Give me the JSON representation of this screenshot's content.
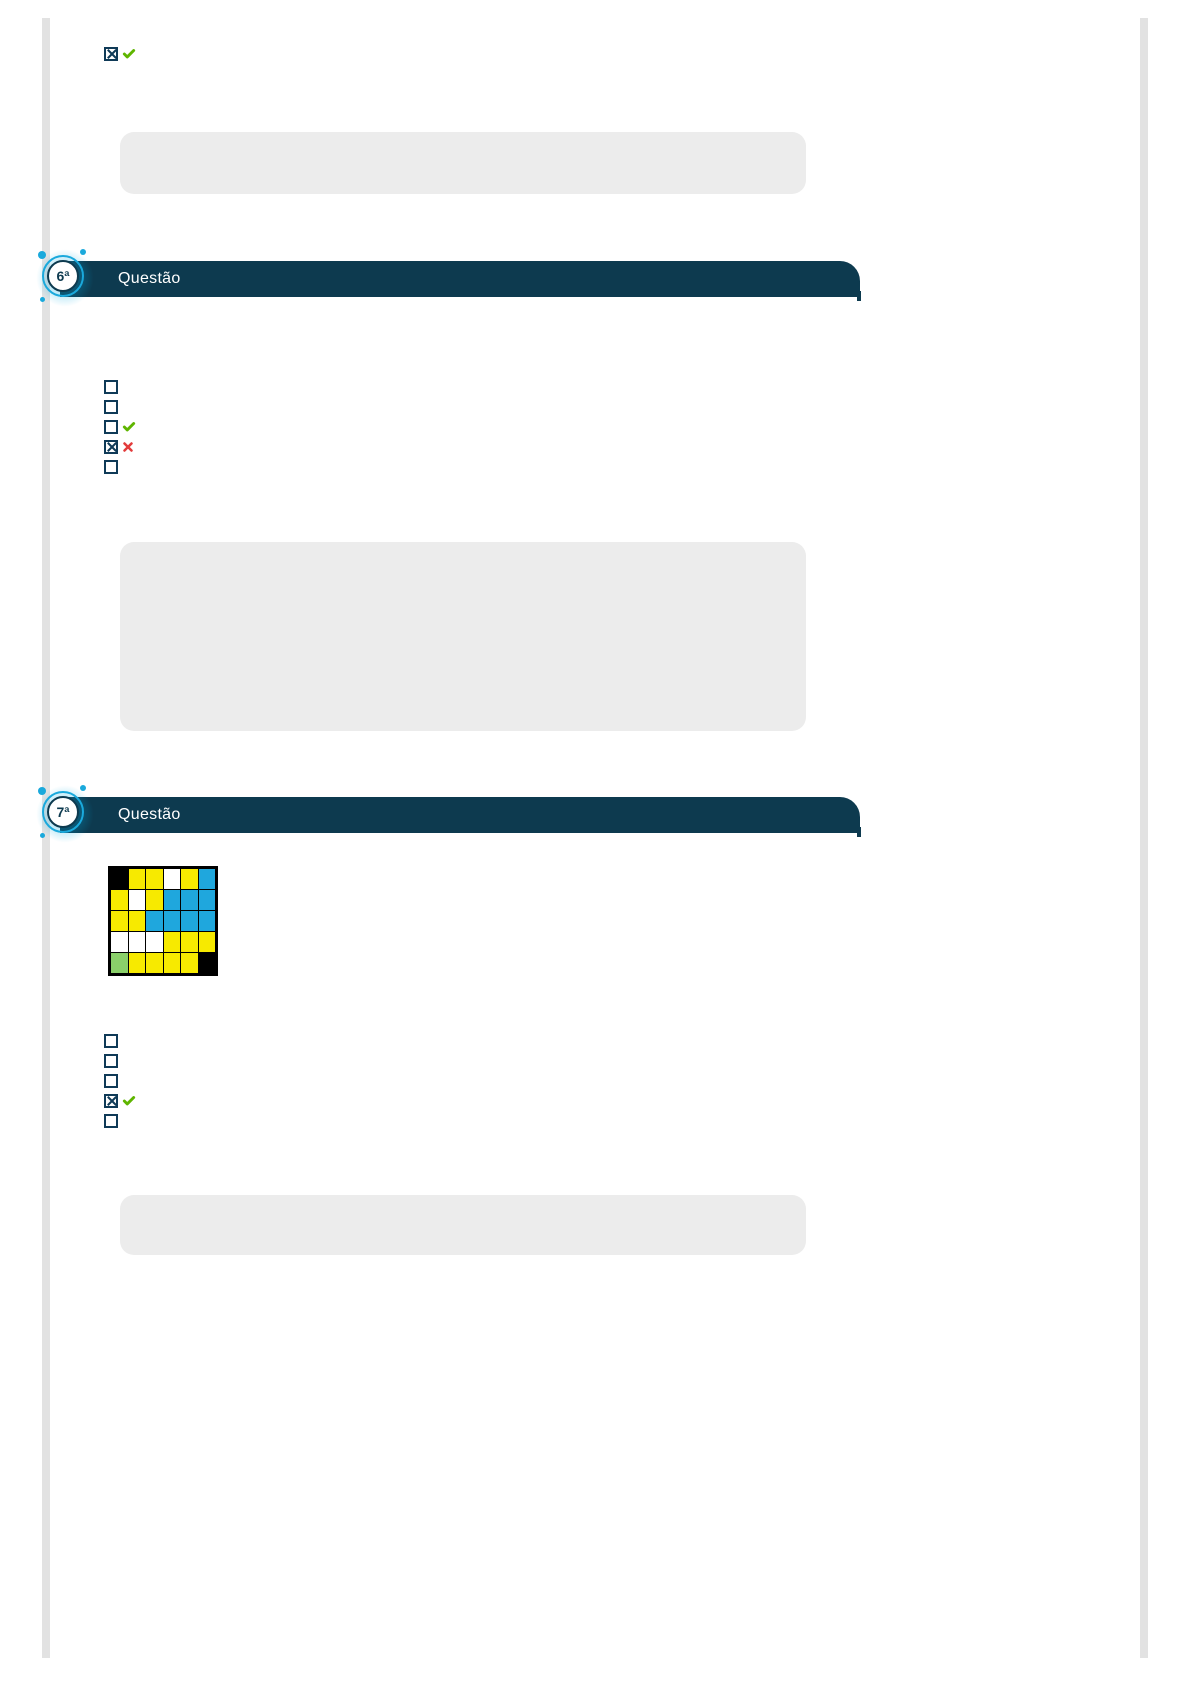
{
  "question_label": "Questão",
  "question5": {
    "answers": [
      {
        "checked": true,
        "mark": "correct"
      }
    ]
  },
  "question6": {
    "number": "6ª",
    "answers": [
      {
        "checked": false,
        "mark": null
      },
      {
        "checked": false,
        "mark": null
      },
      {
        "checked": false,
        "mark": "correct"
      },
      {
        "checked": true,
        "mark": "wrong"
      },
      {
        "checked": false,
        "mark": null
      }
    ]
  },
  "question7": {
    "number": "7ª",
    "grid": [
      [
        "k",
        "y",
        "y",
        "w",
        "y",
        "b"
      ],
      [
        "y",
        "w",
        "y",
        "b",
        "b",
        "b"
      ],
      [
        "y",
        "y",
        "b",
        "b",
        "b",
        "b"
      ],
      [
        "w",
        "w",
        "w",
        "y",
        "y",
        "y"
      ],
      [
        "g",
        "y",
        "y",
        "y",
        "y",
        "k"
      ]
    ],
    "answers": [
      {
        "checked": false,
        "mark": null
      },
      {
        "checked": false,
        "mark": null
      },
      {
        "checked": false,
        "mark": null
      },
      {
        "checked": true,
        "mark": "correct"
      },
      {
        "checked": false,
        "mark": null
      }
    ]
  }
}
